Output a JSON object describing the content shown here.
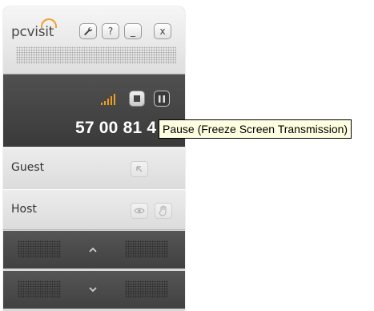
{
  "app": {
    "logo_text": "pcvisit"
  },
  "header": {
    "buttons": [
      {
        "name": "settings",
        "icon": "wrench-icon"
      },
      {
        "name": "help",
        "label": "?"
      },
      {
        "name": "minimize",
        "label": "_"
      },
      {
        "name": "close",
        "label": "x"
      }
    ]
  },
  "display": {
    "session_code": "57 00 81 4",
    "signal_icon": "signal-strength-icon",
    "signal_color": "#f0a020"
  },
  "rows": {
    "guest_label": "Guest",
    "host_label": "Host"
  },
  "tooltip": {
    "text": "Pause (Freeze Screen Transmission)"
  }
}
